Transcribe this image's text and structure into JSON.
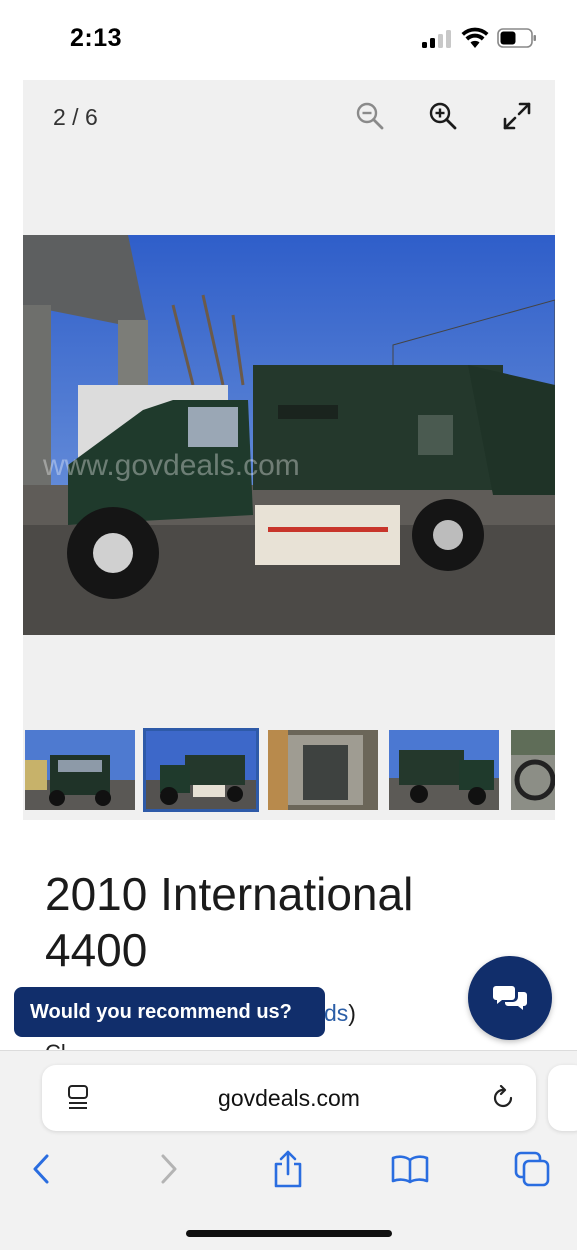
{
  "status_bar": {
    "time": "2:13"
  },
  "gallery": {
    "counter": "2 / 6",
    "controls": [
      "zoom-out-icon",
      "zoom-in-icon",
      "expand-icon"
    ],
    "main_image": {
      "subject": "green garbage truck, side view",
      "watermark": "www.govdeals.com"
    },
    "thumbnails": [
      {
        "subject": "truck front view",
        "selected": false
      },
      {
        "subject": "truck side view",
        "selected": true
      },
      {
        "subject": "truck rear mechanism",
        "selected": false
      },
      {
        "subject": "truck side view",
        "selected": false
      },
      {
        "subject": "truck interior",
        "selected": false
      }
    ]
  },
  "listing": {
    "title_line1": "2010 International",
    "title_line2": "4400",
    "partial_link": "ds",
    "partial_paren": ")"
  },
  "recommend": {
    "label": "Would you recommend us?"
  },
  "chat": {
    "icon": "chat-bubbles-icon"
  },
  "browser": {
    "url": "govdeals.com",
    "nav": [
      "back-icon",
      "forward-icon",
      "share-icon",
      "bookmarks-icon",
      "tabs-icon"
    ]
  },
  "colors": {
    "brand": "#112e6b",
    "link": "#2b5ea7",
    "thumb_selected": "#2e5aa8"
  }
}
